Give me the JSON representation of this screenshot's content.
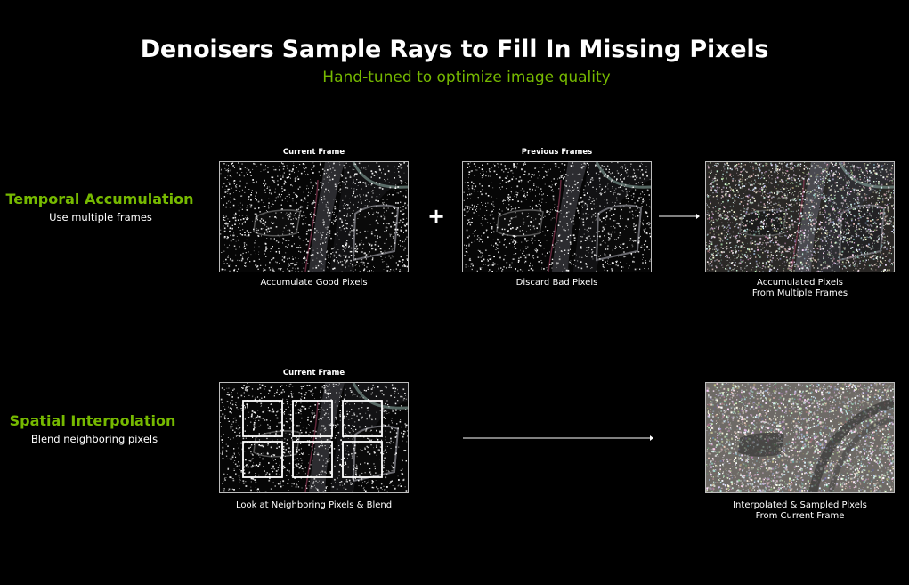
{
  "header": {
    "title": "Denoisers Sample Rays to Fill In Missing Pixels",
    "subtitle": "Hand-tuned to optimize image quality"
  },
  "temporal": {
    "title": "Temporal Accumulation",
    "subtitle": "Use multiple frames",
    "current_label": "Current Frame",
    "previous_label": "Previous Frames",
    "operator": "+",
    "caption_current": "Accumulate Good Pixels",
    "caption_previous": "Discard Bad Pixels",
    "caption_result": [
      "Accumulated Pixels",
      "From Multiple Frames"
    ]
  },
  "spatial": {
    "title": "Spatial Interpolation",
    "subtitle": "Blend neighboring pixels",
    "current_label": "Current Frame",
    "caption_current": "Look at Neighboring Pixels & Blend",
    "caption_result": [
      "Interpolated & Sampled Pixels",
      "From Current Frame"
    ]
  },
  "colors": {
    "accent": "#76b900",
    "background": "#000000",
    "text": "#ffffff"
  }
}
